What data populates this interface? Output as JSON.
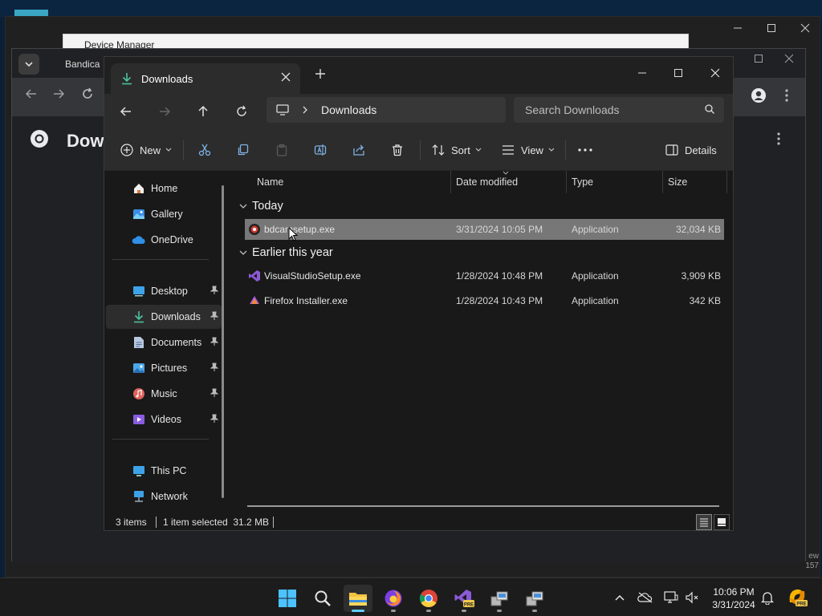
{
  "background": {
    "device_manager_title": "Device Manager",
    "chrome_tab_label": "Bandica",
    "chrome_page_title": "Dow",
    "side_note": "ew\n157"
  },
  "explorer": {
    "tab_title": "Downloads",
    "address_path": "Downloads",
    "search_placeholder": "Search Downloads",
    "commands": {
      "new_label": "New",
      "sort_label": "Sort",
      "view_label": "View",
      "details_label": "Details"
    },
    "nav": {
      "items": [
        {
          "label": "Home",
          "icon": "home-icon"
        },
        {
          "label": "Gallery",
          "icon": "gallery-icon"
        },
        {
          "label": "OneDrive",
          "icon": "cloud-icon"
        },
        {
          "label": "Desktop",
          "icon": "desktop-icon"
        },
        {
          "label": "Downloads",
          "icon": "download-icon"
        },
        {
          "label": "Documents",
          "icon": "document-icon"
        },
        {
          "label": "Pictures",
          "icon": "picture-icon"
        },
        {
          "label": "Music",
          "icon": "music-icon"
        },
        {
          "label": "Videos",
          "icon": "video-icon"
        },
        {
          "label": "This PC",
          "icon": "pc-icon"
        },
        {
          "label": "Network",
          "icon": "network-icon"
        }
      ]
    },
    "columns": [
      "Name",
      "Date modified",
      "Type",
      "Size"
    ],
    "groups": [
      {
        "label": "Today",
        "files": [
          {
            "name": "bdcamsetup.exe",
            "date": "3/31/2024 10:05 PM",
            "type": "Application",
            "size": "32,034 KB",
            "selected": true
          }
        ]
      },
      {
        "label": "Earlier this year",
        "files": [
          {
            "name": "VisualStudioSetup.exe",
            "date": "1/28/2024 10:48 PM",
            "type": "Application",
            "size": "3,909 KB",
            "selected": false
          },
          {
            "name": "Firefox Installer.exe",
            "date": "1/28/2024 10:43 PM",
            "type": "Application",
            "size": "342 KB",
            "selected": false
          }
        ]
      }
    ],
    "status": {
      "item_count": "3 items",
      "selection": "1 item selected  31.2 MB"
    }
  },
  "taskbar": {
    "clock_time": "10:06 PM",
    "clock_date": "3/31/2024",
    "pre_badge": "PRE"
  },
  "colors": {
    "accent": "#60cdff",
    "selection": "#777777",
    "window_bg": "#191919",
    "toolbar_bg": "#2c2c2c"
  }
}
